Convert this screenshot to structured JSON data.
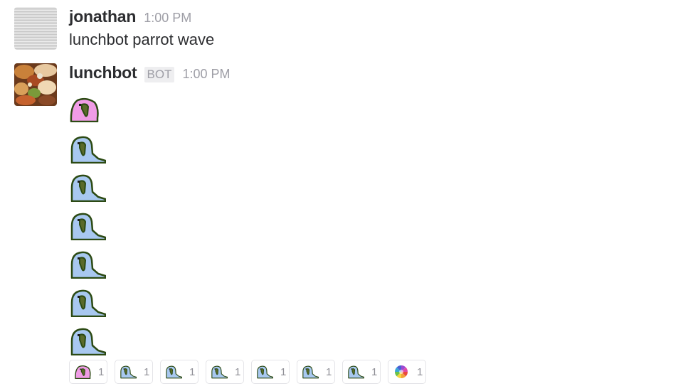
{
  "messages": [
    {
      "user": "jonathan",
      "time": "1:00 PM",
      "text": "lunchbot parrot wave",
      "avatar_icon": "striped-gray-avatar"
    },
    {
      "user": "lunchbot",
      "badge": "BOT",
      "time": "1:00 PM",
      "avatar_icon": "food-photo-avatar",
      "parrots": [
        {
          "icon": "parrot-pink-icon",
          "color": "#f09ce6"
        },
        {
          "icon": "parrot-blue-icon",
          "color": "#a8c8f0"
        },
        {
          "icon": "parrot-blue-icon",
          "color": "#a8c8f0"
        },
        {
          "icon": "parrot-blue-icon",
          "color": "#a8c8f0"
        },
        {
          "icon": "parrot-blue-icon",
          "color": "#a8c8f0"
        },
        {
          "icon": "parrot-blue-icon",
          "color": "#a8c8f0"
        },
        {
          "icon": "parrot-blue-icon",
          "color": "#a8c8f0"
        }
      ]
    }
  ],
  "reactions": [
    {
      "icon": "parrot-pink-icon",
      "count": "1"
    },
    {
      "icon": "parrot-blue-icon",
      "count": "1"
    },
    {
      "icon": "parrot-blue-icon",
      "count": "1"
    },
    {
      "icon": "parrot-blue-icon",
      "count": "1"
    },
    {
      "icon": "parrot-blue-icon",
      "count": "1"
    },
    {
      "icon": "parrot-blue-icon",
      "count": "1"
    },
    {
      "icon": "parrot-blue-icon",
      "count": "1"
    },
    {
      "icon": "color-wheel-icon",
      "count": "1"
    }
  ],
  "colors": {
    "parrot_outline": "#2c4a14",
    "parrot_pink": "#f09ce6",
    "parrot_blue": "#a8c8f0",
    "name_text": "#2c2d30",
    "muted_text": "#9e9ea6"
  }
}
